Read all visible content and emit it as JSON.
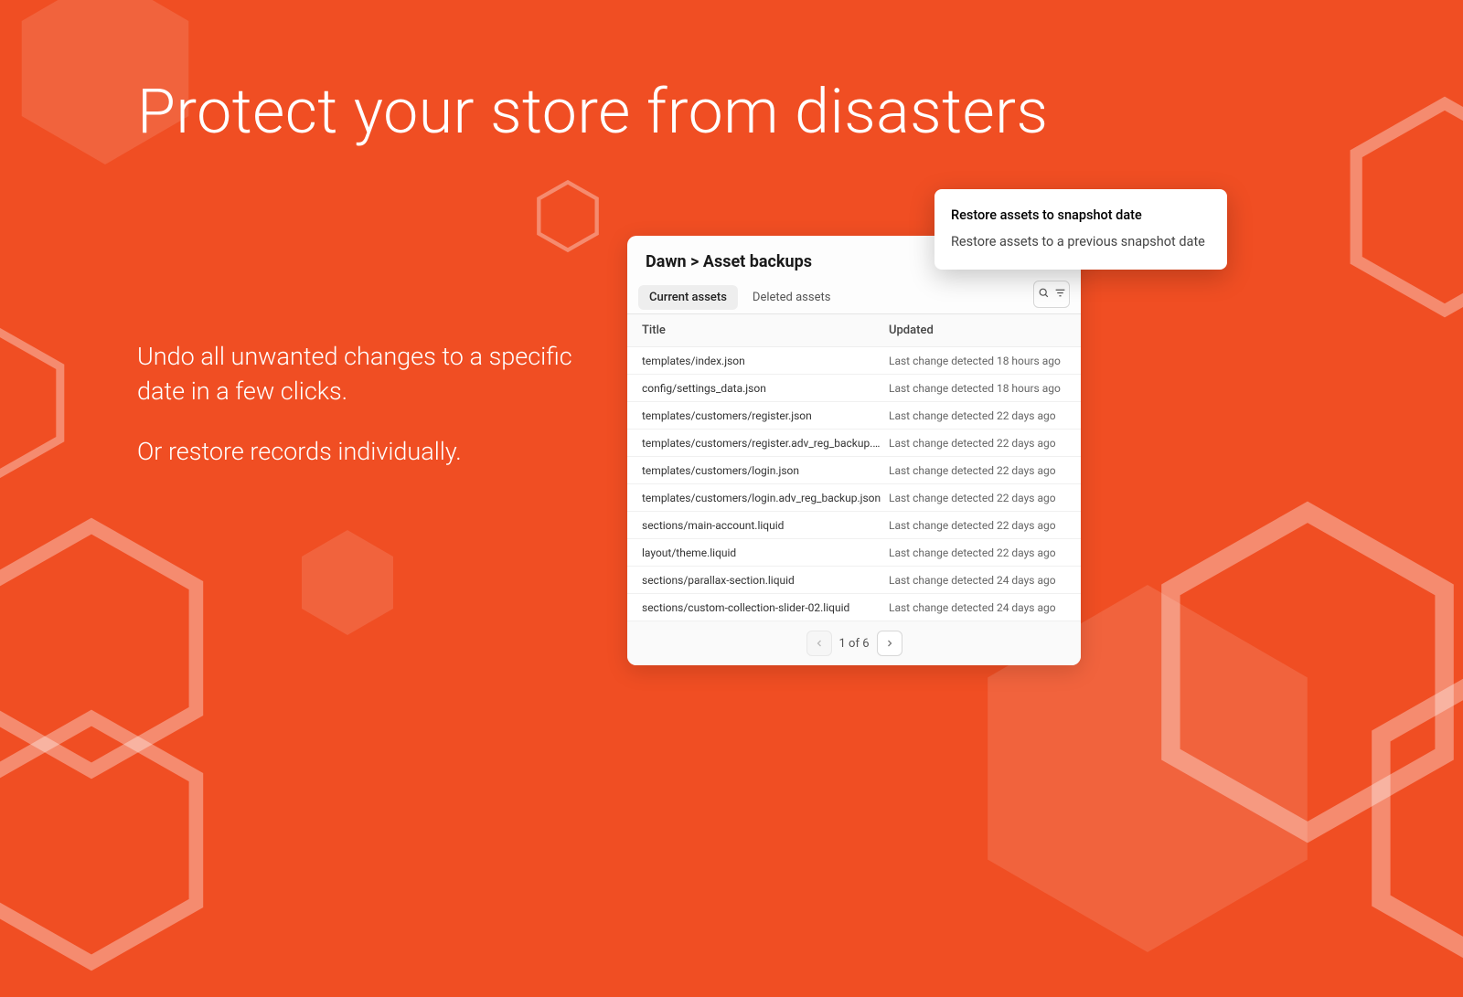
{
  "headline": "Protect your store from disasters",
  "copy": {
    "line1": "Undo all unwanted changes to a specific date in a few clicks.",
    "line2": "Or restore records individually."
  },
  "panel": {
    "breadcrumb": "Dawn > Asset backups",
    "tabs": {
      "current": "Current assets",
      "deleted": "Deleted assets"
    },
    "columns": {
      "title": "Title",
      "updated": "Updated"
    },
    "rows": [
      {
        "title": "templates/index.json",
        "updated": "Last change detected 18 hours ago"
      },
      {
        "title": "config/settings_data.json",
        "updated": "Last change detected 18 hours ago"
      },
      {
        "title": "templates/customers/register.json",
        "updated": "Last change detected 22 days ago"
      },
      {
        "title": "templates/customers/register.adv_reg_backup.json",
        "updated": "Last change detected 22 days ago"
      },
      {
        "title": "templates/customers/login.json",
        "updated": "Last change detected 22 days ago"
      },
      {
        "title": "templates/customers/login.adv_reg_backup.json",
        "updated": "Last change detected 22 days ago"
      },
      {
        "title": "sections/main-account.liquid",
        "updated": "Last change detected 22 days ago"
      },
      {
        "title": "layout/theme.liquid",
        "updated": "Last change detected 22 days ago"
      },
      {
        "title": "sections/parallax-section.liquid",
        "updated": "Last change detected 24 days ago"
      },
      {
        "title": "sections/custom-collection-slider-02.liquid",
        "updated": "Last change detected 24 days ago"
      }
    ],
    "pager": {
      "text": "1 of 6"
    }
  },
  "popover": {
    "item1": "Restore assets to snapshot date",
    "item2": "Restore assets to a previous snapshot date"
  }
}
